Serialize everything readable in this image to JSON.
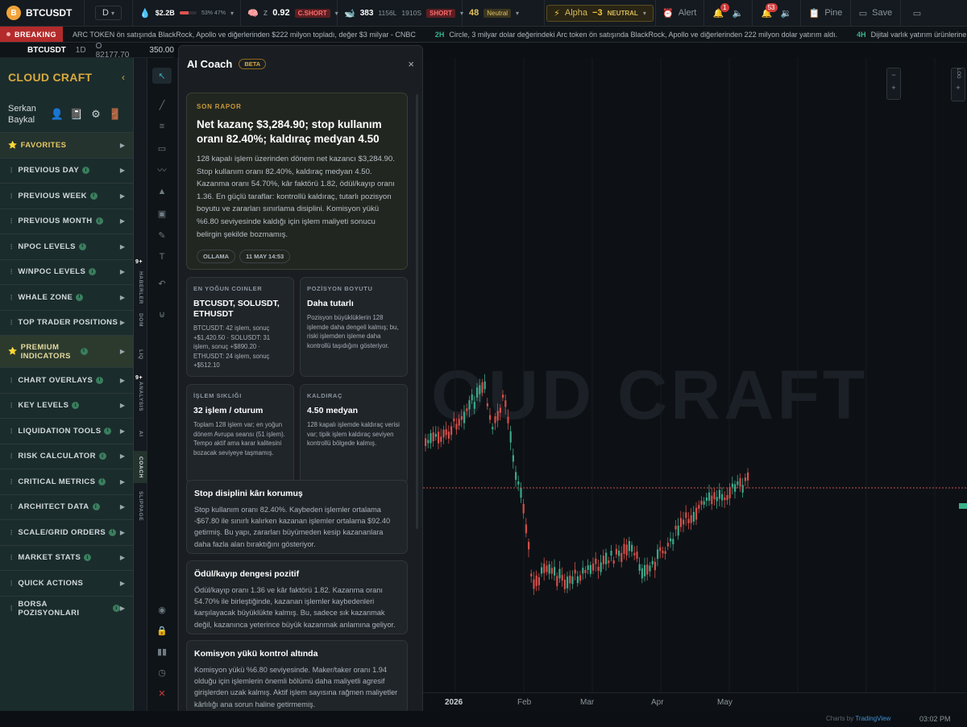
{
  "topbar": {
    "symbol": "BTCUSDT",
    "coin_letter": "B",
    "timeframe": "D",
    "liquidity": "$2.2B",
    "liquidity_pct": "53% 47%",
    "liquidity_fill": 0.53,
    "z_label": "z",
    "z_value": "0.92",
    "z_badge": "C.SHORT",
    "whale_count": "383",
    "whale_long": "1156L",
    "whale_short": "1910S",
    "whale_badge": "SHORT",
    "fg_value": "48",
    "fg_badge": "Neutral",
    "alpha_label": "Alpha",
    "alpha_value": "−3",
    "alpha_state": "NEUTRAL",
    "alert_label": "Alert",
    "bell1_count": "1",
    "bell2_count": "53",
    "pine_label": "Pine",
    "save_label": "Save"
  },
  "ticker": {
    "breaking": "BREAKING",
    "items": [
      {
        "age": "",
        "text": "ARC TOKEN ön satışında BlackRock, Apollo ve diğerlerinden $222 milyon topladı, değer $3 milyar - CNBC"
      },
      {
        "age": "2H",
        "text": "Circle, 3 milyar dolar değerindeki Arc token ön satışında BlackRock, Apollo ve diğerlerinden 222 milyon dolar yatırım aldı."
      },
      {
        "age": "4H",
        "text": "Dijital varlık yatırım ürünlerine 857,9 milyon dolarl"
      }
    ]
  },
  "symbar": {
    "symbol": "BTCUSDT",
    "interval": "1D",
    "price": "O 82177.70",
    "price_right": "350.00"
  },
  "sidebar": {
    "brand": "CLOUD CRAFT",
    "collapse": "‹",
    "user_first": "Serkan",
    "user_last": "Baykal",
    "items": [
      {
        "label": "FAVORITES",
        "info": false
      },
      {
        "label": "PREVIOUS DAY",
        "info": true
      },
      {
        "label": "PREVIOUS WEEK",
        "info": true
      },
      {
        "label": "PREVIOUS MONTH",
        "info": true
      },
      {
        "label": "NPOC LEVELS",
        "info": true
      },
      {
        "label": "W/NPOC LEVELS",
        "info": true
      },
      {
        "label": "WHALE ZONE",
        "info": true
      },
      {
        "label": "TOP TRADER POSITIONS",
        "info": false
      },
      {
        "label": "PREMIUM INDICATORS",
        "info": true
      },
      {
        "label": "CHART OVERLAYS",
        "info": true
      },
      {
        "label": "KEY LEVELS",
        "info": true
      },
      {
        "label": "LIQUIDATION TOOLS",
        "info": true
      },
      {
        "label": "RISK CALCULATOR",
        "info": true
      },
      {
        "label": "CRITICAL METRICS",
        "info": true
      },
      {
        "label": "ARCHITECT DATA",
        "info": true
      },
      {
        "label": "SCALE/GRID ORDERS",
        "info": true
      },
      {
        "label": "MARKET STATS",
        "info": true
      },
      {
        "label": "QUICK ACTIONS",
        "info": false
      },
      {
        "label": "BORSA POZISYONLARI",
        "info": true
      }
    ]
  },
  "vtabs": [
    {
      "label": "HABERLER",
      "badge": "9+"
    },
    {
      "label": "DOM",
      "badge": ""
    },
    {
      "label": "LIQ",
      "badge": ""
    },
    {
      "label": "ANALYSIS",
      "badge": "9+"
    },
    {
      "label": "AI",
      "badge": ""
    },
    {
      "label": "COACH",
      "badge": ""
    },
    {
      "label": "SLIPPAGE",
      "badge": ""
    }
  ],
  "coach": {
    "title": "AI Coach",
    "beta": "BETA",
    "close": "×",
    "report": {
      "kicker": "SON RAPOR",
      "title": "Net kazanç $3,284.90; stop kullanım oranı 82.40%; kaldıraç medyan 4.50",
      "body": "128 kapalı işlem üzerinden dönem net kazancı $3,284.90. Stop kullanım oranı 82.40%, kaldıraç medyan 4.50. Kazanma oranı 54.70%, kâr faktörü 1.82, ödül/kayıp oranı 1.36. En güçlü taraflar: kontrollü kaldıraç, tutarlı pozisyon boyutu ve zararları sınırlama disiplini. Komisyon yükü %6.80 seviyesinde kaldığı için işlem maliyeti sonucu belirgin şekilde bozmamış.",
      "chip1": "OLLAMA",
      "chip2": "11 MAY 14:53"
    },
    "small_cards": [
      {
        "kicker": "EN YOĞUN COINLER",
        "title": "BTCUSDT, SOLUSDT, ETHUSDT",
        "body": "BTCUSDT: 42 işlem, sonuç +$1,420.50 · SOLUSDT: 31 işlem, sonuç +$890.20 · ETHUSDT: 24 işlem, sonuç +$512.10"
      },
      {
        "kicker": "POZİSYON BOYUTU",
        "title": "Daha tutarlı",
        "body": "Pozisyon büyüklüklerin 128 işlemde daha dengeli kalmış; bu, riski işlemden işleme daha kontrollü taşıdığını gösteriyor."
      },
      {
        "kicker": "İŞLEM SIKLIĞI",
        "title": "32 işlem / oturum",
        "body": "Toplam 128 işlem var; en yoğun dönem Avrupa seansı (51 işlem). Tempo aktif ama karar kalitesini bozacak seviyeye taşmamış."
      },
      {
        "kicker": "KALDIRAÇ",
        "title": "4.50 medyan",
        "body": "128 kapalı işlemde kaldıraç verisi var; tipik işlem kaldıraç seviyen kontrollü bölgede kalmış."
      }
    ],
    "insights": [
      {
        "title": "Stop disiplini kârı korumuş",
        "body": "Stop kullanım oranı 82.40%. Kaybeden işlemler ortalama -$67.80 ile sınırlı kalırken kazanan işlemler ortalama $92.40 getirmiş. Bu yapı, zararları büyümeden kesip kazananlara daha fazla alan bıraktığını gösteriyor."
      },
      {
        "title": "Ödül/kayıp dengesi pozitif",
        "body": "Ödül/kayıp oranı 1.36 ve kâr faktörü 1.82. Kazanma oranı 54.70% ile birleştiğinde, kazanan işlemler kaybedenleri karşılayacak büyüklükte kalmış. Bu, sadece sık kazanmak değil, kazanınca yeterince büyük kazanmak anlamına geliyor."
      },
      {
        "title": "Komisyon yükü kontrol altında",
        "body": "Komisyon yükü %6.80 seviyesinde. Maker/taker oranı 1.94 olduğu için işlemlerin önemli bölümü daha maliyetli agresif girişlerden uzak kalmış. Aktif işlem sayısına rağmen maliyetler kârlılığı ana sorun haline getirmemiş."
      }
    ]
  },
  "chart": {
    "watermark": "OUD CRAFT",
    "x_labels": [
      "2026",
      "Feb",
      "Mar",
      "Apr",
      "May"
    ],
    "zoom_plus": "+",
    "zoom_minus": "−",
    "log_label": "LOG"
  },
  "footer": {
    "tv_prefix": "Charts by ",
    "tv_brand": "TradingView",
    "clock": "03:02 PM"
  }
}
